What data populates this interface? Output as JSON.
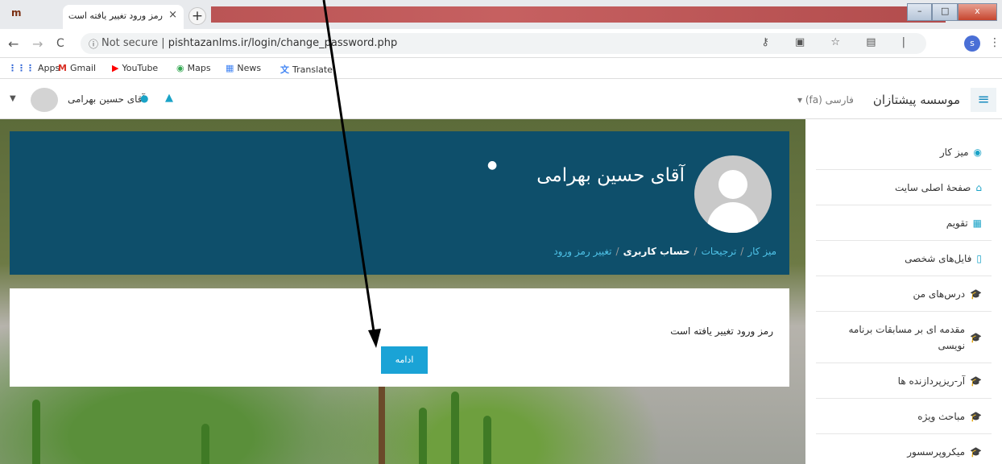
{
  "browser": {
    "tab_title": "رمز ورود تغییر یافته است",
    "tab_close": "×",
    "new_tab": "+",
    "window_buttons": [
      "–",
      "□",
      "x"
    ],
    "favicon": "m",
    "nav": {
      "back": "←",
      "forward": "→",
      "reload": "C"
    },
    "url_info": "ⓘ",
    "url_prefix": "Not secure | ",
    "url": "pishtazanlms.ir/login/change_password.php",
    "omnibox_icons": "⚷ ▣ ☆ ▤ |",
    "profile_letter": "s",
    "menu": "⋮"
  },
  "bookmarks": [
    {
      "icon": "⋮⋮⋮",
      "label": "Apps",
      "color": "#3367d6"
    },
    {
      "icon": "M",
      "label": "Gmail",
      "color": "#d93025"
    },
    {
      "icon": "▶",
      "label": "YouTube",
      "color": "#ff0000"
    },
    {
      "icon": "◉",
      "label": "Maps",
      "color": "#34a853"
    },
    {
      "icon": "▦",
      "label": "News",
      "color": "#4285f4"
    },
    {
      "icon": "文",
      "label": "Translate",
      "color": "#4285f4"
    }
  ],
  "navbar": {
    "menu_icon": "≡",
    "site_name": "موسسه پیشتازان",
    "language": "فارسی (fa) ▾",
    "user_name": "آقای حسین بهرامی",
    "caret": "▼",
    "message_icon": "●",
    "bell_icon": "▲"
  },
  "header": {
    "full_name": "آقای حسین بهرامی",
    "message_bubble": "●",
    "breadcrumbs": [
      {
        "label": "میز کار",
        "link": true
      },
      {
        "label": "ترجیحات",
        "link": true
      },
      {
        "label": "حساب کاربری",
        "link": false
      },
      {
        "label": "تغییر رمز ورود",
        "link": true
      }
    ],
    "separator": "/"
  },
  "main": {
    "message": "رمز ورود تغییر یافته است",
    "continue_label": "ادامه"
  },
  "sidebar": {
    "items": [
      {
        "icon": "◉",
        "label": "میز کار"
      },
      {
        "icon": "⌂",
        "label": "صفحهٔ اصلی سایت"
      },
      {
        "icon": "▦",
        "label": "تقویم"
      },
      {
        "icon": "▯",
        "label": "فایل‌های شخصی"
      },
      {
        "icon": "🎓",
        "label": "درس‌های من"
      },
      {
        "icon": "🎓",
        "label": "مقدمه ای بر مسابقات برنامه نویسی"
      },
      {
        "icon": "🎓",
        "label": "آر-ریزپردازنده ها"
      },
      {
        "icon": "🎓",
        "label": "مباحث ویژه"
      },
      {
        "icon": "🎓",
        "label": "میکروپرسسور"
      }
    ]
  },
  "colors": {
    "header_bg": "#0e4f6b",
    "accent": "#1aa3d6",
    "link": "#4fc3e8"
  }
}
